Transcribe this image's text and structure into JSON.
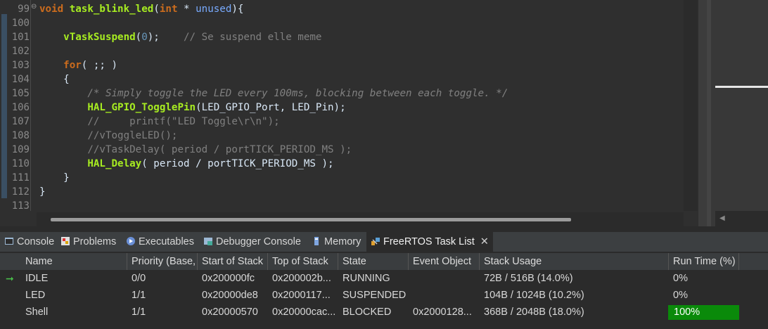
{
  "editor": {
    "line_numbers": [
      "99",
      "100",
      "101",
      "102",
      "103",
      "104",
      "105",
      "106",
      "107",
      "108",
      "109",
      "110",
      "111",
      "112",
      "113"
    ],
    "lines": [
      [
        {
          "t": "void ",
          "c": "kw"
        },
        {
          "t": "task_blink_led",
          "c": "fn"
        },
        {
          "t": "(",
          "c": ""
        },
        {
          "t": "int",
          "c": "kw"
        },
        {
          "t": " * ",
          "c": ""
        },
        {
          "t": "unused",
          "c": "id"
        },
        {
          "t": "){",
          "c": ""
        }
      ],
      [],
      [
        {
          "t": "    ",
          "c": ""
        },
        {
          "t": "vTaskSuspend",
          "c": "fn"
        },
        {
          "t": "(",
          "c": ""
        },
        {
          "t": "0",
          "c": "num"
        },
        {
          "t": ");    ",
          "c": ""
        },
        {
          "t": "// Se suspend elle meme",
          "c": "cm"
        }
      ],
      [],
      [
        {
          "t": "    ",
          "c": ""
        },
        {
          "t": "for",
          "c": "kw"
        },
        {
          "t": "( ;; )",
          "c": ""
        }
      ],
      [
        {
          "t": "    {",
          "c": ""
        }
      ],
      [
        {
          "t": "        ",
          "c": ""
        },
        {
          "t": "/* Simply toggle the LED every 100ms, blocking between each toggle. */",
          "c": "ci"
        }
      ],
      [
        {
          "t": "        ",
          "c": ""
        },
        {
          "t": "HAL_GPIO_TogglePin",
          "c": "fn"
        },
        {
          "t": "(LED_GPIO_Port, LED_Pin);",
          "c": ""
        }
      ],
      [
        {
          "t": "        ",
          "c": ""
        },
        {
          "t": "//     printf(\"LED Toggle\\r\\n\");",
          "c": "cm"
        }
      ],
      [
        {
          "t": "        ",
          "c": ""
        },
        {
          "t": "//vToggleLED();",
          "c": "cm"
        }
      ],
      [
        {
          "t": "        ",
          "c": ""
        },
        {
          "t": "//vTaskDelay( period / portTICK_PERIOD_MS );",
          "c": "cm"
        }
      ],
      [
        {
          "t": "        ",
          "c": ""
        },
        {
          "t": "HAL_Delay",
          "c": "fn"
        },
        {
          "t": "( period / portTICK_PERIOD_MS );",
          "c": ""
        }
      ],
      [
        {
          "t": "    }",
          "c": ""
        }
      ],
      [
        {
          "t": "}",
          "c": ""
        }
      ],
      []
    ]
  },
  "tabs": [
    {
      "label": "Console",
      "icon": "console-icon",
      "active": false
    },
    {
      "label": "Problems",
      "icon": "problems-icon",
      "active": false
    },
    {
      "label": "Executables",
      "icon": "executables-icon",
      "active": false
    },
    {
      "label": "Debugger Console",
      "icon": "debugger-console-icon",
      "active": false
    },
    {
      "label": "Memory",
      "icon": "memory-icon",
      "active": false
    },
    {
      "label": "FreeRTOS Task List",
      "icon": "freertos-icon",
      "active": true
    }
  ],
  "table": {
    "columns": [
      "Name",
      "Priority (Base,",
      "Start of Stack",
      "Top of Stack",
      "State",
      "Event Object",
      "Stack Usage",
      "Run Time (%)"
    ],
    "rows": [
      {
        "name": "IDLE",
        "priority": "0/0",
        "start": "0x200000fc",
        "top": "0x200002b...",
        "state": "RUNNING",
        "event": "",
        "stack": "72B / 516B (14.0%)",
        "runtime": "0%",
        "runtime_fraction": 0,
        "running": true
      },
      {
        "name": "LED",
        "priority": "1/1",
        "start": "0x20000de8",
        "top": "0x2000117...",
        "state": "SUSPENDED",
        "event": "",
        "stack": "104B / 1024B (10.2%)",
        "runtime": "0%",
        "runtime_fraction": 0,
        "running": false
      },
      {
        "name": "Shell",
        "priority": "1/1",
        "start": "0x20000570",
        "top": "0x20000cac...",
        "state": "BLOCKED",
        "event": "0x2000128...",
        "stack": "368B / 2048B (18.0%)",
        "runtime": "100%",
        "runtime_fraction": 1,
        "running": false
      }
    ]
  },
  "colors": {
    "runtime_bar": "#0a8a0a",
    "running_marker": "#49c34b"
  }
}
